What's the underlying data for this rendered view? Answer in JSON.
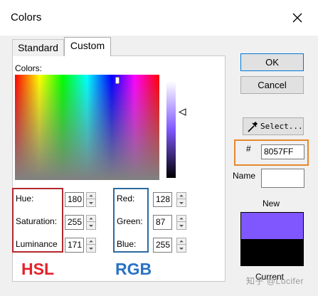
{
  "window": {
    "title": "Colors"
  },
  "tabs": [
    {
      "label": "Standard",
      "selected": false
    },
    {
      "label": "Custom",
      "selected": true
    }
  ],
  "custom": {
    "colors_label": "Colors:",
    "hsl": {
      "hue": {
        "label": "Hue:",
        "value": "180"
      },
      "saturation": {
        "label": "Saturation:",
        "value": "255"
      },
      "luminance": {
        "label": "Luminance",
        "value": "171"
      }
    },
    "rgb": {
      "red": {
        "label": "Red:",
        "value": "128"
      },
      "green": {
        "label": "Green:",
        "value": "87"
      },
      "blue": {
        "label": "Blue:",
        "value": "255"
      }
    },
    "annotations": {
      "hsl": "HSL",
      "rgb": "RGB"
    }
  },
  "buttons": {
    "ok": "OK",
    "cancel": "Cancel",
    "select": "Select..."
  },
  "hex": {
    "hash": "#",
    "value": "8057FF"
  },
  "name": {
    "label": "Name",
    "value": ""
  },
  "preview": {
    "new_label": "New",
    "current_label": "Current",
    "new_color": "#8057ff",
    "current_color": "#000000"
  },
  "watermark": "知乎 @Lucifer",
  "colors": {
    "hsl_annotation": "#b3282d",
    "rgb_annotation": "#2c6aa0",
    "hex_annotation": "#e5892f",
    "selected_color": "#8057ff"
  }
}
